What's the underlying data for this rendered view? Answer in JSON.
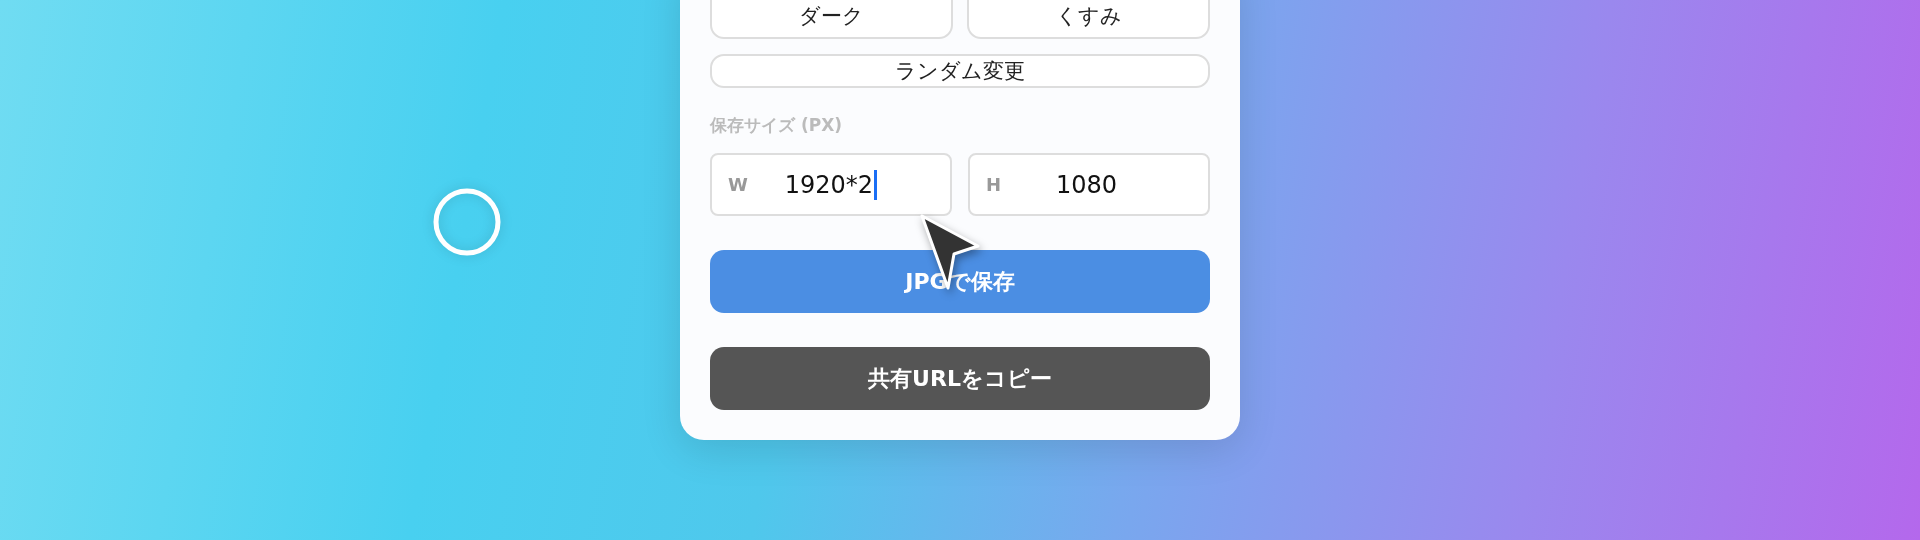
{
  "theme_buttons": [
    {
      "label": "ダーク"
    },
    {
      "label": "くすみ"
    }
  ],
  "random_button": {
    "label": "ランダム変更"
  },
  "size_section": {
    "label": "保存サイズ (PX)",
    "fields": [
      {
        "label": "W",
        "value": "1920*2",
        "focused": true
      },
      {
        "label": "H",
        "value": "1080",
        "focused": false
      }
    ]
  },
  "actions": [
    {
      "label": "JPGで保存",
      "kind": "primary"
    },
    {
      "label": "共有URLをコピー",
      "kind": "dark"
    }
  ]
}
